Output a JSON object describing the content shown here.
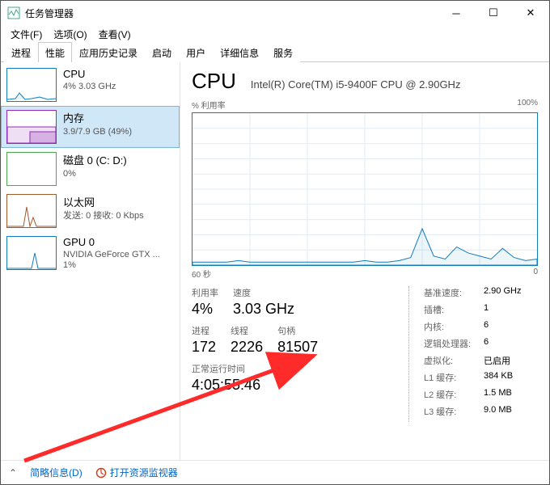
{
  "window": {
    "title": "任务管理器"
  },
  "menu": {
    "file": "文件(F)",
    "options": "选项(O)",
    "view": "查看(V)"
  },
  "tabs": [
    "进程",
    "性能",
    "应用历史记录",
    "启动",
    "用户",
    "详细信息",
    "服务"
  ],
  "active_tab": 1,
  "sidebar": {
    "items": [
      {
        "name": "CPU",
        "val": "4% 3.03 GHz"
      },
      {
        "name": "内存",
        "val": "3.9/7.9 GB (49%)"
      },
      {
        "name": "磁盘 0 (C: D:)",
        "val": "0%"
      },
      {
        "name": "以太网",
        "val": "发送: 0 接收: 0 Kbps"
      },
      {
        "name": "GPU 0",
        "val": "NVIDIA GeForce GTX ...\n1%"
      }
    ],
    "selected": 1
  },
  "main": {
    "title": "CPU",
    "model": "Intel(R) Core(TM) i5-9400F CPU @ 2.90GHz",
    "chart_tl": "% 利用率",
    "chart_tr": "100%",
    "chart_bl": "60 秒",
    "chart_br": "0",
    "stats": {
      "util_lbl": "利用率",
      "util_val": "4%",
      "speed_lbl": "速度",
      "speed_val": "3.03 GHz",
      "proc_lbl": "进程",
      "proc_val": "172",
      "thr_lbl": "线程",
      "thr_val": "2226",
      "hnd_lbl": "句柄",
      "hnd_val": "81507",
      "uptime_lbl": "正常运行时间",
      "uptime_val": "4:05:55:46"
    },
    "specs": {
      "base_k": "基准速度:",
      "base_v": "2.90 GHz",
      "sock_k": "插槽:",
      "sock_v": "1",
      "core_k": "内核:",
      "core_v": "6",
      "lp_k": "逻辑处理器:",
      "lp_v": "6",
      "virt_k": "虚拟化:",
      "virt_v": "已启用",
      "l1_k": "L1 缓存:",
      "l1_v": "384 KB",
      "l2_k": "L2 缓存:",
      "l2_v": "1.5 MB",
      "l3_k": "L3 缓存:",
      "l3_v": "9.0 MB"
    }
  },
  "footer": {
    "less": "简略信息(D)",
    "resmon": "打开资源监视器"
  },
  "chart_data": {
    "type": "line",
    "title": "% 利用率",
    "xlabel": "60 秒",
    "ylabel": "% 利用率",
    "xlim": [
      60,
      0
    ],
    "ylim": [
      0,
      100
    ],
    "x": [
      60,
      58,
      56,
      54,
      52,
      50,
      48,
      46,
      44,
      42,
      40,
      38,
      36,
      34,
      32,
      30,
      28,
      26,
      24,
      22,
      20,
      18,
      16,
      14,
      12,
      10,
      8,
      6,
      4,
      2,
      0
    ],
    "values": [
      2,
      2,
      2,
      2,
      3,
      2,
      2,
      2,
      2,
      2,
      2,
      2,
      2,
      2,
      2,
      3,
      2,
      2,
      3,
      5,
      24,
      6,
      4,
      12,
      8,
      6,
      4,
      11,
      5,
      3,
      4
    ]
  }
}
